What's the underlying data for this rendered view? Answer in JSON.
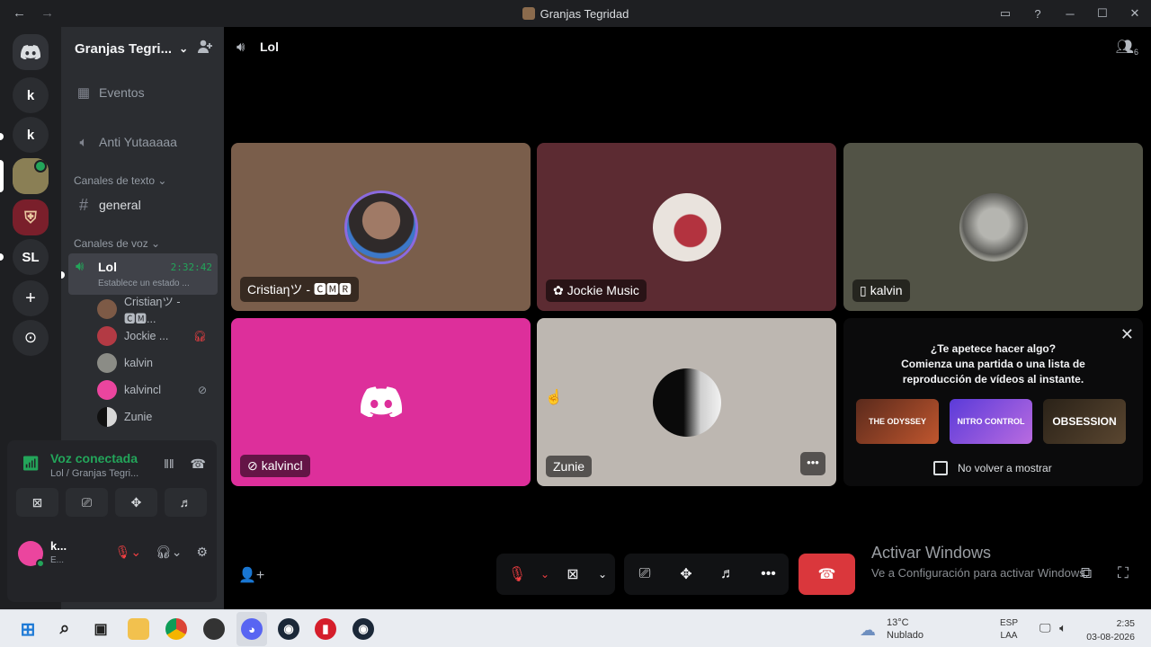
{
  "window": {
    "title": "Granjas Tegridad",
    "back_icon": "←",
    "forward_icon": "→",
    "inbox_icon": "▭",
    "help_icon": "?",
    "minimize_icon": "─",
    "maximize_icon": "☐",
    "close_icon": "✕"
  },
  "guilds": {
    "home_icon": "discord-logo",
    "items": [
      {
        "label": "k"
      },
      {
        "label": "k"
      },
      {
        "label": ""
      },
      {
        "label": ""
      },
      {
        "label": "SL"
      }
    ],
    "add_label": "+",
    "discover_label": "⊙"
  },
  "server": {
    "name": "Granjas Tegri...",
    "chevron": "⌄",
    "invite_icon": "👤+"
  },
  "channels": {
    "events": "Eventos",
    "anti": "Anti Yutaaaaa",
    "text_category": "Canales de texto",
    "general": "general",
    "voice_category": "Canales de voz",
    "active_voice": {
      "name": "Lol",
      "time": "2:32:42",
      "status": "Establece un estado ..."
    },
    "voice_users": [
      {
        "name": "Cristiaηツ - 🅲🅼..."
      },
      {
        "name": "Jockie ..."
      },
      {
        "name": "kalvin"
      },
      {
        "name": "kalvincl"
      },
      {
        "name": "Zunie"
      }
    ]
  },
  "voice_panel": {
    "status": "Voz conectada",
    "location": "Lol / Granjas Tegri...",
    "user_name": "k...",
    "user_status": "E..."
  },
  "main": {
    "channel_title": "Lol",
    "activity_count": "6"
  },
  "tiles": [
    {
      "label": "Cristiaηツ - 🅲🅼🆁",
      "color": "#7a5e4b"
    },
    {
      "label": "Jockie Music",
      "color": "#5c2b32"
    },
    {
      "label": "kalvin",
      "color": "#525346"
    },
    {
      "label": "kalvincl",
      "color": "#dd2f9b"
    },
    {
      "label": "Zunie",
      "color": "#bdb7b1"
    }
  ],
  "suggestion": {
    "line1": "¿Te apetece hacer algo?",
    "line2": "Comienza una partida o una lista de",
    "line3": "reproducción de vídeos al instante.",
    "games": [
      "THE ODYSSEY",
      "NITRO CONTROL",
      "OBSESSION"
    ],
    "dont_show": "No volver a mostrar"
  },
  "activation": {
    "title": "Activar Windows",
    "subtitle": "Ve a Configuración para activar Windows."
  },
  "taskbar": {
    "weather_temp": "13°C",
    "weather_cond": "Nublado",
    "lang1": "ESP",
    "lang2": "LAA",
    "time": "2:35",
    "date": "03-08-2026"
  }
}
